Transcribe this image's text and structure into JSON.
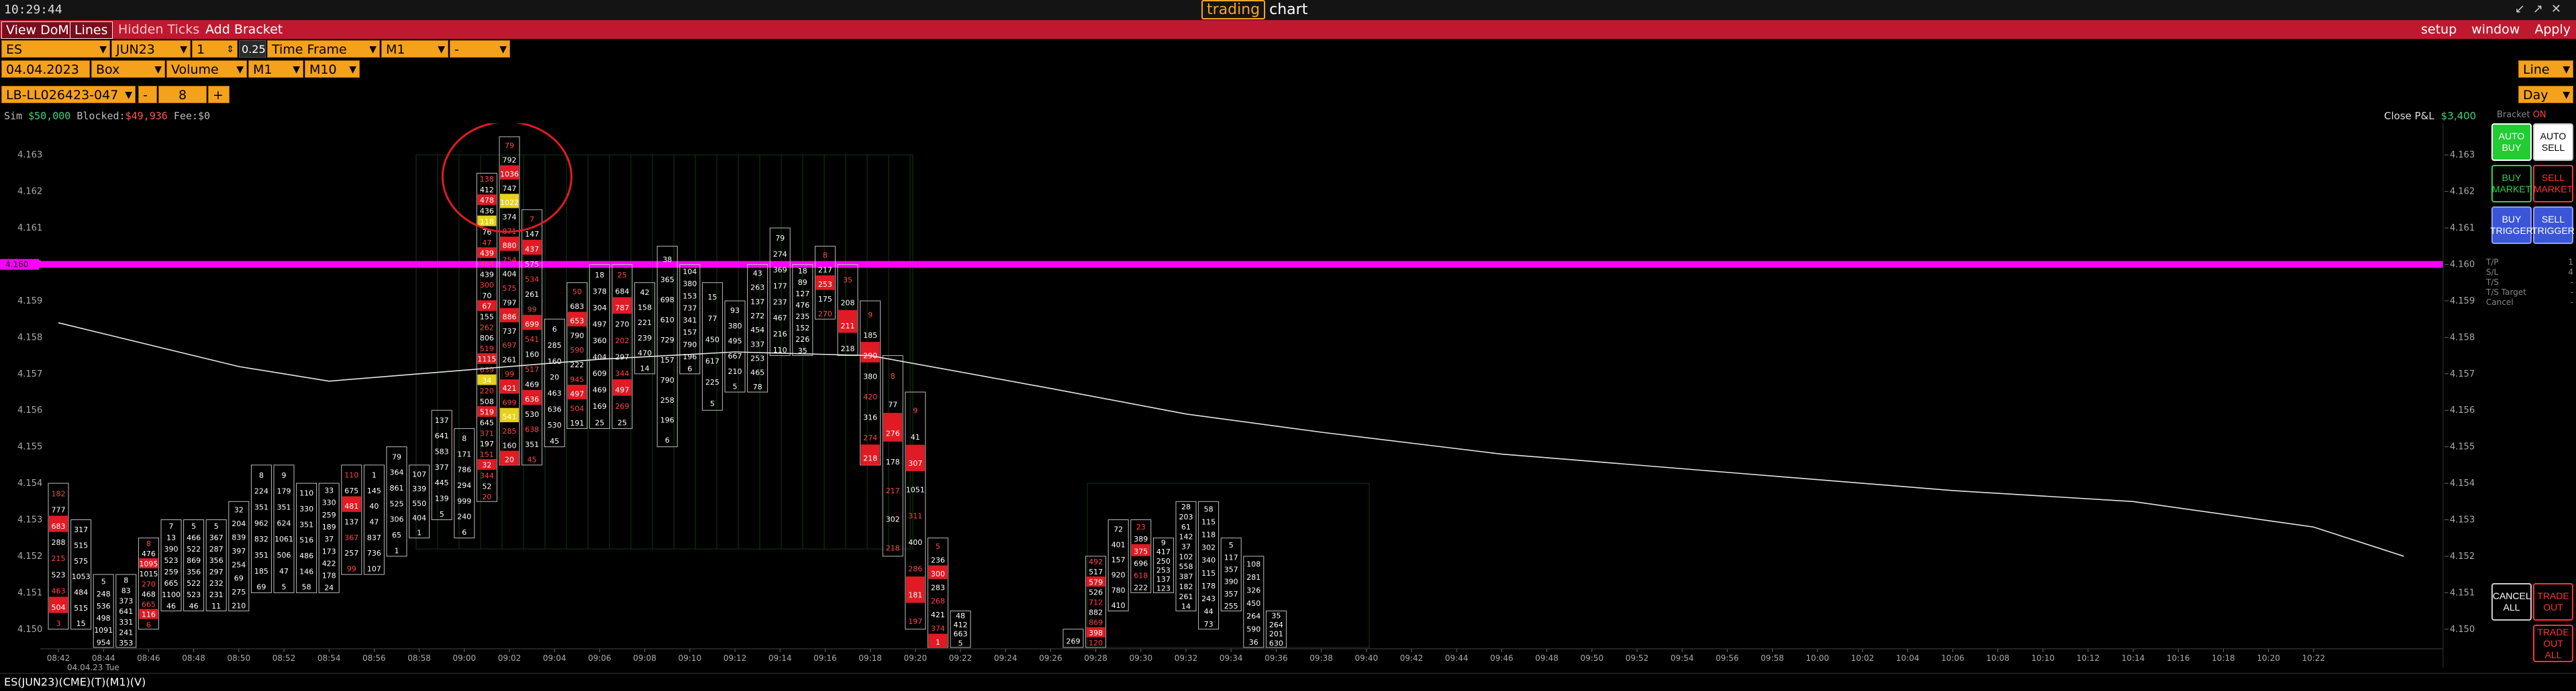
{
  "titlebar": {
    "clock": "10:29:44",
    "app_brand": "trading",
    "app_word": "chart"
  },
  "menubar": {
    "view_dom": "View DoM",
    "lines": "Lines",
    "hidden_ticks": "Hidden Ticks",
    "add_bracket": "Add Bracket",
    "setup": "setup",
    "window": "window",
    "apply": "Apply"
  },
  "controls": {
    "symbol": "ES",
    "contract": "JUN23",
    "qty": "1",
    "tick": "0.25",
    "timeframe_label": "Time Frame",
    "timeframe_value": "M1",
    "timeframe_extra": "-",
    "date": "04.04.2023",
    "box": "Box",
    "volume": "Volume",
    "m1": "M1",
    "m10": "M10",
    "account": "LB-LL026423-047",
    "minus": "-",
    "account_qty": "8",
    "plus": "+",
    "line_mode": "Line",
    "day_mode": "Day"
  },
  "info": {
    "sim_label": "Sim",
    "sim_value": "$50,000",
    "blocked_label": "Blocked:",
    "blocked_value": "$49,936",
    "fee_label": "Fee:",
    "fee_value": "$0",
    "close_pl_label": "Close P&L",
    "close_pl_value": "$3,400",
    "bracket_label": "Bracket",
    "bracket_value": "ON"
  },
  "colors": {
    "accent_orange": "#f4a21c",
    "menu_red": "#c0192f",
    "magenta_line": "#ff00ff",
    "sell_red": "#e01b24",
    "highlight_yellow": "#e6d21a",
    "buy_green": "#22cc33",
    "grid_green": "#0f3a17"
  },
  "chart_data": {
    "type": "footprint",
    "price_labels": [
      "4.163",
      "4.162",
      "4.161",
      "4.160",
      "4.159",
      "4.158",
      "4.157",
      "4.156",
      "4.155",
      "4.154",
      "4.153",
      "4.152",
      "4.151",
      "4.150"
    ],
    "price_range": [
      4.1495,
      4.1635
    ],
    "highlighted_price": "4.160",
    "time_labels": [
      "08:42",
      "08:44",
      "08:46",
      "08:48",
      "08:50",
      "08:52",
      "08:54",
      "08:56",
      "08:58",
      "09:00",
      "09:02",
      "09:04",
      "09:06",
      "09:08",
      "09:10",
      "09:12",
      "09:14",
      "09:16",
      "09:18",
      "09:20",
      "09:22",
      "09:24",
      "09:26",
      "09:28",
      "09:30",
      "09:32",
      "09:34",
      "09:36",
      "09:38",
      "09:40",
      "09:42",
      "09:44",
      "09:46",
      "09:48",
      "09:50",
      "09:52",
      "09:54",
      "09:56",
      "09:58",
      "10:00",
      "10:02",
      "10:04",
      "10:06",
      "10:08",
      "10:10",
      "10:12",
      "10:14",
      "10:16",
      "10:18",
      "10:20",
      "10:22"
    ],
    "date_label": "04.04.23 Tue",
    "vwap": [
      [
        0,
        4.1584
      ],
      [
        4,
        4.1578
      ],
      [
        8,
        4.1572
      ],
      [
        12,
        4.1568
      ],
      [
        18,
        4.1571
      ],
      [
        24,
        4.1574
      ],
      [
        30,
        4.1576
      ],
      [
        36,
        4.1575
      ],
      [
        44,
        4.1566
      ],
      [
        50,
        4.1559
      ],
      [
        56,
        4.1554
      ],
      [
        64,
        4.1548
      ],
      [
        74,
        4.1543
      ],
      [
        84,
        4.1538
      ],
      [
        92,
        4.1535
      ],
      [
        100,
        4.1528
      ],
      [
        104,
        4.152
      ]
    ],
    "bars": [
      {
        "i": 0,
        "lo": 4.15,
        "hi": 4.154,
        "sell": true,
        "vols": [
          "182",
          "777",
          "683",
          "288",
          "215",
          "523",
          "463",
          "504",
          "3"
        ]
      },
      {
        "i": 1,
        "lo": 4.15,
        "hi": 4.153,
        "vols": [
          "317",
          "515",
          "575",
          "1053",
          "484",
          "515",
          "15"
        ]
      },
      {
        "i": 2,
        "lo": 4.1495,
        "hi": 4.1515,
        "vols": [
          "5",
          "248",
          "536",
          "498",
          "1091",
          "954"
        ]
      },
      {
        "i": 3,
        "lo": 4.1495,
        "hi": 4.1515,
        "vols": [
          "8",
          "83",
          "373",
          "641",
          "331",
          "241",
          "353"
        ]
      },
      {
        "i": 4,
        "lo": 4.15,
        "hi": 4.1525,
        "sell": true,
        "vols": [
          "8",
          "476",
          "1095",
          "1015",
          "270",
          "468",
          "665",
          "116",
          "6"
        ]
      },
      {
        "i": 5,
        "lo": 4.1505,
        "hi": 4.153,
        "vols": [
          "7",
          "13",
          "390",
          "523",
          "259",
          "665",
          "1100",
          "46"
        ]
      },
      {
        "i": 6,
        "lo": 4.1505,
        "hi": 4.153,
        "vols": [
          "5",
          "466",
          "522",
          "869",
          "356",
          "522",
          "523",
          "46"
        ]
      },
      {
        "i": 7,
        "lo": 4.1505,
        "hi": 4.153,
        "vols": [
          "5",
          "367",
          "287",
          "356",
          "297",
          "232",
          "231",
          "11"
        ]
      },
      {
        "i": 8,
        "lo": 4.1505,
        "hi": 4.1535,
        "vols": [
          "32",
          "204",
          "839",
          "397",
          "254",
          "69",
          "275",
          "210"
        ]
      },
      {
        "i": 9,
        "lo": 4.151,
        "hi": 4.1545,
        "vols": [
          "8",
          "224",
          "351",
          "962",
          "832",
          "351",
          "185",
          "69"
        ]
      },
      {
        "i": 10,
        "lo": 4.151,
        "hi": 4.1545,
        "vols": [
          "9",
          "179",
          "351",
          "624",
          "1061",
          "506",
          "47",
          "5"
        ]
      },
      {
        "i": 11,
        "lo": 4.151,
        "hi": 4.154,
        "vols": [
          "110",
          "330",
          "351",
          "516",
          "486",
          "146",
          "58"
        ]
      },
      {
        "i": 12,
        "lo": 4.151,
        "hi": 4.154,
        "vols": [
          "33",
          "330",
          "259",
          "189",
          "37",
          "173",
          "422",
          "178",
          "24"
        ]
      },
      {
        "i": 13,
        "lo": 4.1515,
        "hi": 4.1545,
        "sell": true,
        "vols": [
          "110",
          "675",
          "481",
          "137",
          "367",
          "257",
          "99"
        ]
      },
      {
        "i": 14,
        "lo": 4.1515,
        "hi": 4.1545,
        "vols": [
          "1",
          "145",
          "40",
          "47",
          "837",
          "736",
          "107"
        ]
      },
      {
        "i": 15,
        "lo": 4.152,
        "hi": 4.155,
        "vols": [
          "79",
          "364",
          "861",
          "525",
          "306",
          "65",
          "1"
        ]
      },
      {
        "i": 16,
        "lo": 4.1525,
        "hi": 4.1545,
        "vols": [
          "107",
          "339",
          "550",
          "404",
          "1"
        ]
      },
      {
        "i": 17,
        "lo": 4.153,
        "hi": 4.156,
        "vols": [
          "137",
          "641",
          "583",
          "377",
          "445",
          "139",
          "5"
        ]
      },
      {
        "i": 18,
        "lo": 4.1525,
        "hi": 4.1555,
        "vols": [
          "8",
          "171",
          "786",
          "294",
          "999",
          "240",
          "6"
        ]
      },
      {
        "i": 19,
        "lo": 4.1535,
        "hi": 4.1625,
        "sell": true,
        "hilite": true,
        "vols": [
          "138",
          "412",
          "478",
          "436",
          "118",
          "76",
          "47",
          "439",
          "464",
          "439",
          "300",
          "70",
          "67",
          "155",
          "262",
          "806",
          "519",
          "1115",
          "639",
          "34",
          "220",
          "508",
          "519",
          "645",
          "371",
          "197",
          "151",
          "32",
          "344",
          "52",
          "20"
        ]
      },
      {
        "i": 20,
        "lo": 4.1545,
        "hi": 4.1635,
        "sell": true,
        "hilite": true,
        "vols": [
          "79",
          "792",
          "1036",
          "747",
          "1022",
          "374",
          "871",
          "880",
          "754",
          "404",
          "575",
          "797",
          "886",
          "737",
          "697",
          "261",
          "99",
          "421",
          "699",
          "541",
          "285",
          "160",
          "20"
        ]
      },
      {
        "i": 21,
        "lo": 4.1545,
        "hi": 4.1615,
        "sell": true,
        "vols": [
          "7",
          "147",
          "437",
          "575",
          "534",
          "261",
          "99",
          "699",
          "541",
          "160",
          "517",
          "469",
          "636",
          "530",
          "638",
          "351",
          "45"
        ]
      },
      {
        "i": 22,
        "lo": 4.155,
        "hi": 4.1585,
        "vols": [
          "6",
          "285",
          "160",
          "20",
          "463",
          "636",
          "530",
          "45"
        ]
      },
      {
        "i": 23,
        "lo": 4.1555,
        "hi": 4.1595,
        "sell": true,
        "vols": [
          "50",
          "683",
          "653",
          "790",
          "590",
          "222",
          "945",
          "497",
          "504",
          "191"
        ]
      },
      {
        "i": 24,
        "lo": 4.1555,
        "hi": 4.16,
        "vols": [
          "18",
          "378",
          "304",
          "497",
          "360",
          "404",
          "609",
          "469",
          "169",
          "25"
        ]
      },
      {
        "i": 25,
        "lo": 4.1555,
        "hi": 4.16,
        "sell": true,
        "vols": [
          "25",
          "684",
          "787",
          "270",
          "202",
          "297",
          "344",
          "497",
          "269",
          "25"
        ]
      },
      {
        "i": 26,
        "lo": 4.157,
        "hi": 4.1595,
        "vols": [
          "42",
          "158",
          "221",
          "239",
          "470",
          "14"
        ]
      },
      {
        "i": 27,
        "lo": 4.155,
        "hi": 4.1605,
        "vols": [
          "38",
          "365",
          "698",
          "610",
          "729",
          "157",
          "790",
          "258",
          "196",
          "6"
        ]
      },
      {
        "i": 28,
        "lo": 4.157,
        "hi": 4.16,
        "vols": [
          "104",
          "380",
          "153",
          "737",
          "341",
          "157",
          "790",
          "196",
          "6"
        ]
      },
      {
        "i": 29,
        "lo": 4.156,
        "hi": 4.1595,
        "vols": [
          "15",
          "77",
          "450",
          "617",
          "225",
          "5"
        ]
      },
      {
        "i": 30,
        "lo": 4.1565,
        "hi": 4.159,
        "vols": [
          "93",
          "380",
          "495",
          "667",
          "210",
          "5"
        ]
      },
      {
        "i": 31,
        "lo": 4.1565,
        "hi": 4.16,
        "vols": [
          "43",
          "263",
          "137",
          "272",
          "454",
          "337",
          "253",
          "465",
          "78"
        ]
      },
      {
        "i": 32,
        "lo": 4.1575,
        "hi": 4.161,
        "vols": [
          "79",
          "274",
          "369",
          "177",
          "237",
          "467",
          "216",
          "110"
        ]
      },
      {
        "i": 33,
        "lo": 4.1575,
        "hi": 4.16,
        "vols": [
          "18",
          "89",
          "127",
          "476",
          "235",
          "152",
          "226",
          "35"
        ]
      },
      {
        "i": 34,
        "lo": 4.1585,
        "hi": 4.1605,
        "sell": true,
        "vols": [
          "8",
          "217",
          "253",
          "175",
          "270"
        ]
      },
      {
        "i": 35,
        "lo": 4.1575,
        "hi": 4.16,
        "sell": true,
        "vols": [
          "35",
          "208",
          "211",
          "218"
        ]
      },
      {
        "i": 36,
        "lo": 4.1545,
        "hi": 4.159,
        "sell": true,
        "vols": [
          "9",
          "185",
          "290",
          "380",
          "420",
          "316",
          "274",
          "218"
        ]
      },
      {
        "i": 37,
        "lo": 4.152,
        "hi": 4.1575,
        "sell": true,
        "vols": [
          "8",
          "77",
          "276",
          "178",
          "217",
          "302",
          "218"
        ]
      },
      {
        "i": 38,
        "lo": 4.15,
        "hi": 4.1565,
        "sell": true,
        "vols": [
          "9",
          "41",
          "307",
          "1051",
          "311",
          "400",
          "286",
          "181",
          "197"
        ]
      },
      {
        "i": 39,
        "lo": 4.1495,
        "hi": 4.1525,
        "sell": true,
        "vols": [
          "5",
          "236",
          "300",
          "283",
          "268",
          "421",
          "374",
          "1"
        ]
      },
      {
        "i": 40,
        "lo": 4.1495,
        "hi": 4.1505,
        "vols": [
          "48",
          "412",
          "663",
          "5"
        ]
      },
      {
        "i": 45,
        "lo": 4.1495,
        "hi": 4.15,
        "vols": [
          "269"
        ]
      },
      {
        "i": 46,
        "lo": 4.1495,
        "hi": 4.152,
        "sell": true,
        "vols": [
          "492",
          "517",
          "579",
          "526",
          "712",
          "882",
          "869",
          "398",
          "120"
        ]
      },
      {
        "i": 47,
        "lo": 4.1505,
        "hi": 4.153,
        "vols": [
          "72",
          "401",
          "157",
          "920",
          "780",
          "410"
        ]
      },
      {
        "i": 48,
        "lo": 4.151,
        "hi": 4.153,
        "sell": true,
        "vols": [
          "23",
          "389",
          "375",
          "696",
          "618",
          "222"
        ]
      },
      {
        "i": 49,
        "lo": 4.151,
        "hi": 4.1525,
        "vols": [
          "9",
          "417",
          "250",
          "253",
          "137",
          "123"
        ]
      },
      {
        "i": 50,
        "lo": 4.1505,
        "hi": 4.1535,
        "vols": [
          "28",
          "203",
          "61",
          "142",
          "37",
          "102",
          "558",
          "387",
          "182",
          "261",
          "14"
        ]
      },
      {
        "i": 51,
        "lo": 4.15,
        "hi": 4.1535,
        "vols": [
          "58",
          "115",
          "118",
          "302",
          "340",
          "115",
          "178",
          "243",
          "44",
          "73"
        ]
      },
      {
        "i": 52,
        "lo": 4.1505,
        "hi": 4.1525,
        "vols": [
          "5",
          "117",
          "357",
          "390",
          "357",
          "255"
        ]
      },
      {
        "i": 53,
        "lo": 4.1495,
        "hi": 4.152,
        "vols": [
          "108",
          "281",
          "326",
          "450",
          "264",
          "590",
          "36"
        ]
      },
      {
        "i": 54,
        "lo": 4.1495,
        "hi": 4.1505,
        "vols": [
          "35",
          "264",
          "201",
          "630"
        ]
      }
    ]
  },
  "right_panel": {
    "auto_buy": "AUTO BUY",
    "auto_sell": "AUTO SELL",
    "buy_market": "BUY MARKET",
    "sell_market": "SELL MARKET",
    "buy_trigger": "BUY TRIGGER",
    "sell_trigger": "SELL TRIGGER",
    "stats": [
      {
        "k": "T/P",
        "v": "1"
      },
      {
        "k": "S/L",
        "v": "4"
      },
      {
        "k": "T/S",
        "v": "-"
      },
      {
        "k": "T/S Target",
        "v": "-"
      },
      {
        "k": "Cancel",
        "v": "-"
      }
    ],
    "cancel_all": "CANCEL ALL",
    "trade_out": "TRADE OUT",
    "trade_out_all": "TRADE OUT ALL"
  },
  "bottom": {
    "instrument": "ES(JUN23)(CME)(T)(M1)(V)"
  }
}
